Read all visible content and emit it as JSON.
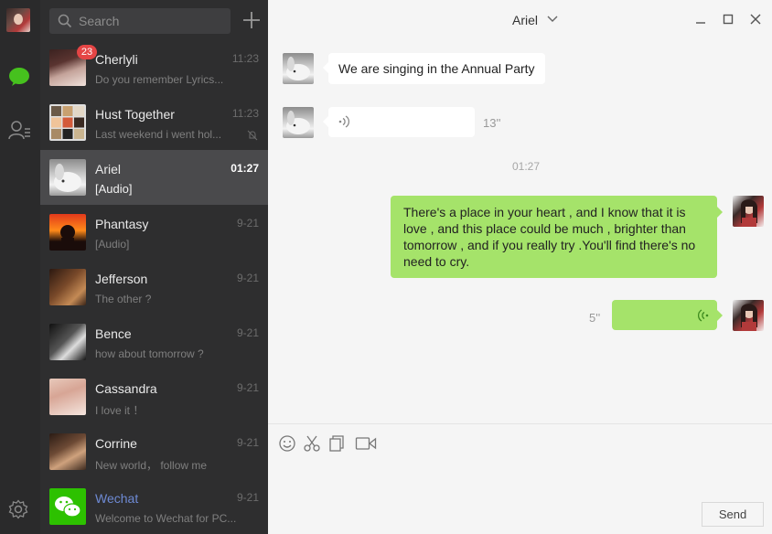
{
  "rail": {
    "items": [
      "profile-avatar",
      "chat-icon",
      "contacts-icon",
      "gear-icon"
    ],
    "accent": "#46c11e"
  },
  "search": {
    "placeholder": "Search"
  },
  "conversations": [
    {
      "name": "Cherlyli",
      "preview": "Do you remember Lyrics...",
      "time": "11:23",
      "badge": "23"
    },
    {
      "name": "Hust Together",
      "preview": "Last weekend i went hol...",
      "time": "11:23",
      "muted": true
    },
    {
      "name": "Ariel",
      "preview": "[Audio]",
      "time": "01:27",
      "active": true
    },
    {
      "name": "Phantasy",
      "preview": "[Audio]",
      "time": "9-21"
    },
    {
      "name": "Jefferson",
      "preview": "The other ?",
      "time": "9-21"
    },
    {
      "name": "Bence",
      "preview": "how about tomorrow ?",
      "time": "9-21"
    },
    {
      "name": "Cassandra",
      "preview": "I love it ！",
      "time": "9-21"
    },
    {
      "name": "Corrine",
      "preview": "New  world， follow me",
      "time": "9-21"
    },
    {
      "name": "Wechat",
      "preview": "Welcome to Wechat for PC...",
      "time": "9-21"
    }
  ],
  "chat": {
    "title": "Ariel",
    "messages": [
      {
        "from": "them",
        "type": "text",
        "text": "We are singing in the Annual Party"
      },
      {
        "from": "them",
        "type": "audio",
        "duration": "13''"
      },
      {
        "type": "timestamp",
        "text": "01:27"
      },
      {
        "from": "me",
        "type": "text",
        "text": "There's a place in your heart , and I know that it is love , and this place could be much , brighter than tomorrow , and if you really try .You'll find there's no need to cry."
      },
      {
        "from": "me",
        "type": "audio",
        "duration": "5''"
      }
    ]
  },
  "composer": {
    "tools": [
      "emoji-icon",
      "scissors-icon",
      "files-icon",
      "video-call-icon"
    ],
    "send_label": "Send"
  },
  "colors": {
    "incoming_bubble": "#ffffff",
    "outgoing_bubble": "#a5e36a",
    "badge": "#e54545"
  }
}
